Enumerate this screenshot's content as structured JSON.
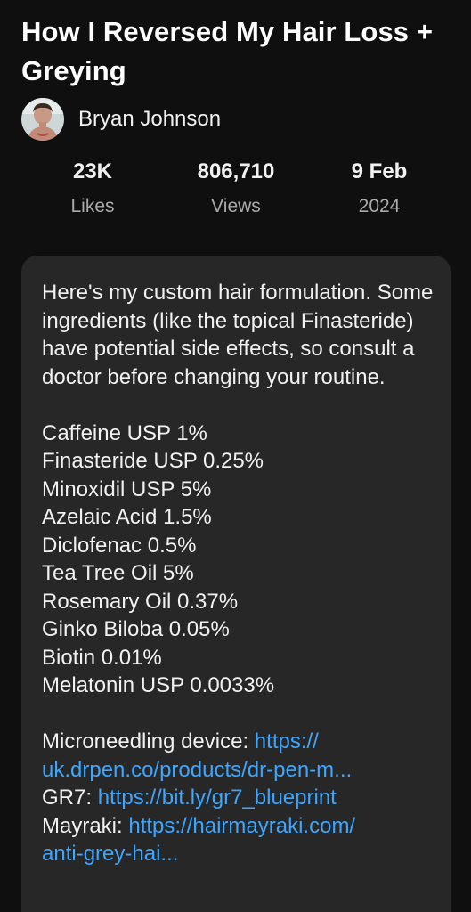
{
  "video": {
    "title": "How I Reversed My Hair Loss + Greying",
    "channel_name": "Bryan Johnson"
  },
  "stats": [
    {
      "top": "23K",
      "bottom": "Likes"
    },
    {
      "top": "806,710",
      "bottom": "Views"
    },
    {
      "top": "9 Feb",
      "bottom": "2024"
    }
  ],
  "description": {
    "intro": "Here's my custom hair formulation. Some ingredients (like the topical Finasteride) have potential side effects, so consult a doctor before changing your routine.",
    "ingredients": [
      "Caffeine USP 1%",
      "Finasteride USP 0.25%",
      "Minoxidil USP 5%",
      "Azelaic Acid 1.5%",
      "Diclofenac 0.5%",
      "Tea Tree Oil 5%",
      "Rosemary Oil 0.37%",
      "Ginko Biloba 0.05%",
      "Biotin 0.01%",
      "Melatonin USP 0.0033%"
    ],
    "links": [
      {
        "label": "Microneedling device: ",
        "url_line1": "https://",
        "url_line2": "uk.drpen.co/products/dr-pen-m..."
      },
      {
        "label": "GR7: ",
        "url": "https://bit.ly/gr7_blueprint"
      },
      {
        "label": "Mayraki: ",
        "url_line1": "https://hairmayraki.com/",
        "url_line2": "anti-grey-hai..."
      }
    ]
  },
  "colors": {
    "background": "#0f0f0f",
    "card": "#272727",
    "link": "#3ea6ff",
    "secondary_text": "#aaaaaa"
  },
  "icons": {
    "avatar": "channel-avatar-photo"
  }
}
